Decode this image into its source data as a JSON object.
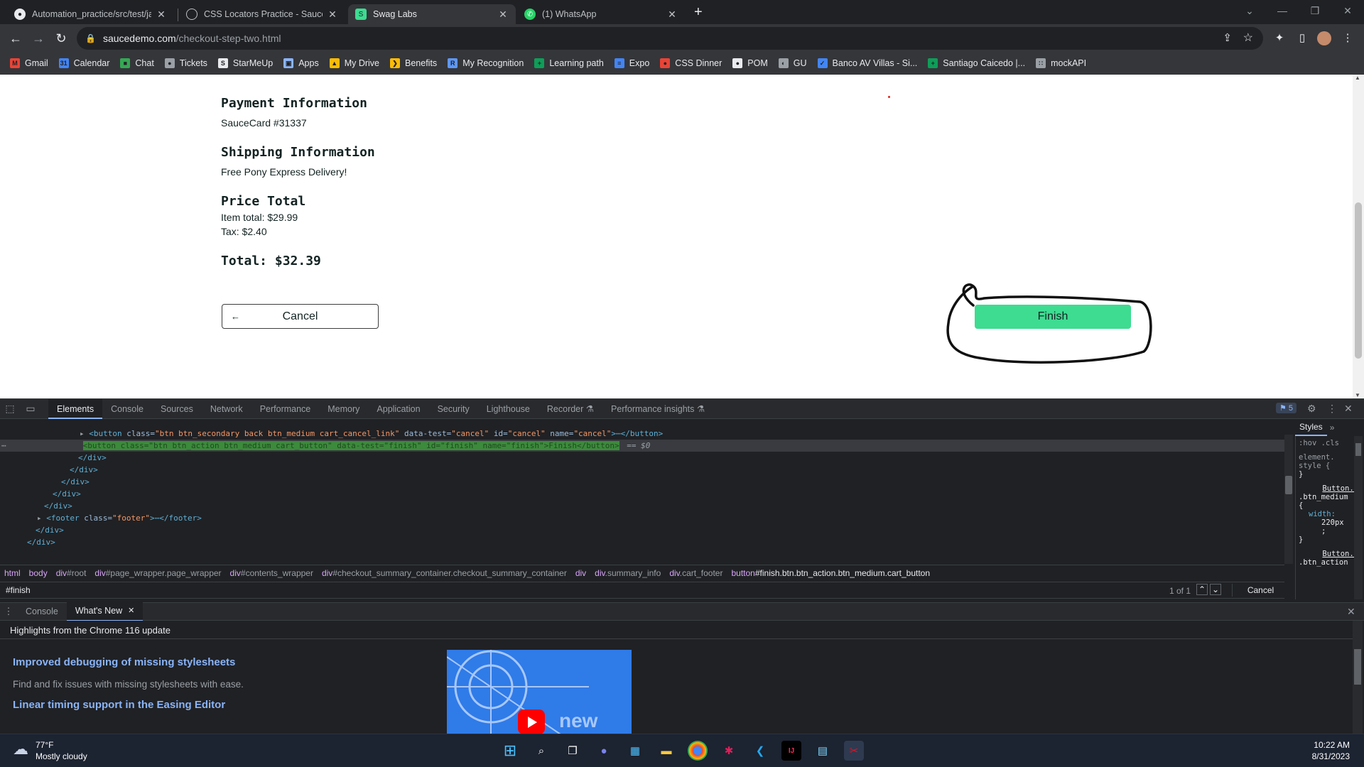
{
  "browser": {
    "tabs": [
      {
        "title": "Automation_practice/src/test/jav",
        "icon": "github-icon",
        "active": false
      },
      {
        "title": "CSS Locators Practice - Saucedem",
        "icon": "globe-icon",
        "active": false
      },
      {
        "title": "Swag Labs",
        "icon": "swag-labs-icon",
        "active": true
      },
      {
        "title": "(1) WhatsApp",
        "icon": "whatsapp-icon",
        "active": false
      }
    ],
    "new_tab": "+",
    "url_host": "saucedemo.com",
    "url_path": "/checkout-step-two.html",
    "bookmarks": [
      {
        "label": "Gmail",
        "color": "#ea4335",
        "glyph": "M"
      },
      {
        "label": "Calendar",
        "color": "#4285f4",
        "glyph": "31"
      },
      {
        "label": "Chat",
        "color": "#34a853",
        "glyph": "■"
      },
      {
        "label": "Tickets",
        "color": "#9aa0a6",
        "glyph": "●"
      },
      {
        "label": "StarMeUp",
        "color": "#e8eaed",
        "glyph": "S"
      },
      {
        "label": "Apps",
        "color": "#8ab4f8",
        "glyph": "▣"
      },
      {
        "label": "My Drive",
        "color": "#fbbc04",
        "glyph": "▲"
      },
      {
        "label": "Benefits",
        "color": "#fbbc04",
        "glyph": "❯"
      },
      {
        "label": "My Recognition",
        "color": "#5e97f6",
        "glyph": "R"
      },
      {
        "label": "Learning path",
        "color": "#0f9d58",
        "glyph": "+"
      },
      {
        "label": "Expo",
        "color": "#4285f4",
        "glyph": "≡"
      },
      {
        "label": "CSS Dinner",
        "color": "#ea4335",
        "glyph": "●"
      },
      {
        "label": "POM",
        "color": "#e8eaed",
        "glyph": "●"
      },
      {
        "label": "GU",
        "color": "#9aa0a6",
        "glyph": "◐"
      },
      {
        "label": "Banco AV Villas - Si...",
        "color": "#4285f4",
        "glyph": "✓"
      },
      {
        "label": "Santiago Caicedo |...",
        "color": "#0f9d58",
        "glyph": "+"
      },
      {
        "label": "mockAPI",
        "color": "#9aa0a6",
        "glyph": "∷"
      }
    ]
  },
  "checkout": {
    "payment_title": "Payment Information",
    "payment_value": "SauceCard #31337",
    "shipping_title": "Shipping Information",
    "shipping_value": "Free Pony Express Delivery!",
    "price_title": "Price Total",
    "item_total": "Item total: $29.99",
    "tax": "Tax: $2.40",
    "total": "Total: $32.39",
    "cancel_label": "Cancel",
    "finish_label": "Finish"
  },
  "devtools": {
    "tabs": [
      "Elements",
      "Console",
      "Sources",
      "Network",
      "Performance",
      "Memory",
      "Application",
      "Security",
      "Lighthouse",
      "Recorder ⚗",
      "Performance insights ⚗"
    ],
    "active_tab": "Elements",
    "issues_count": "5",
    "dom_lines": {
      "l1_open": "<button ",
      "l1_class_n": "class=",
      "l1_class_v": "\"btn btn_secondary back btn_medium cart_cancel_link\"",
      "l1_dt_n": " data-test=",
      "l1_dt_v": "\"cancel\"",
      "l1_id_n": " id=",
      "l1_id_v": "\"cancel\"",
      "l1_name_n": " name=",
      "l1_name_v": "\"cancel\"",
      "l1_close": ">⋯</button>",
      "l2_text": "<button class=\"btn btn_action btn_medium cart_button\" data-test=\"finish\" id=\"finish\" name=\"finish\">Finish</button>",
      "l2_suffix": "== $0",
      "l3": "</div>",
      "l4": "</div>",
      "l5": "</div>",
      "l6": "</div>",
      "l7": "</div>",
      "l8_open": "<footer ",
      "l8_n": "class=",
      "l8_v": "\"footer\"",
      "l8_close": ">⋯</footer>",
      "l9": "</div>",
      "l10": "</div>"
    },
    "breadcrumbs": [
      {
        "tag": "html",
        "rest": ""
      },
      {
        "tag": "body",
        "rest": ""
      },
      {
        "tag": "div",
        "rest": "#root"
      },
      {
        "tag": "div",
        "rest": "#page_wrapper.page_wrapper"
      },
      {
        "tag": "div",
        "rest": "#contents_wrapper"
      },
      {
        "tag": "div",
        "rest": "#checkout_summary_container.checkout_summary_container"
      },
      {
        "tag": "div",
        "rest": ""
      },
      {
        "tag": "div",
        "rest": ".summary_info"
      },
      {
        "tag": "div",
        "rest": ".cart_footer"
      },
      {
        "tag": "button",
        "rest": "#finish.btn.btn_action.btn_medium.cart_button"
      }
    ],
    "search_value": "#finish",
    "search_count": "1 of 1",
    "search_cancel": "Cancel",
    "styles": {
      "tab": "Styles",
      "filter": ":hov .cls",
      "element_style": "element.",
      "element_style2": "style {",
      "rule_close": "}",
      "selector1": "Button.…",
      "selector2": ".btn_medium",
      "brace": "{",
      "prop": "width:",
      "value": "220px",
      "semi": ";",
      "rule_close2": "}",
      "selector3": "Button.…",
      "selector4": ".btn_action"
    },
    "drawer_tabs": [
      "Console",
      "What's New"
    ],
    "whats_new": {
      "header": "Highlights from the Chrome 116 update",
      "item1_title": "Improved debugging of missing stylesheets",
      "item1_desc": "Find and fix issues with missing stylesheets with ease.",
      "item2_title": "Linear timing support in the Easing Editor",
      "video_word": "new"
    }
  },
  "taskbar": {
    "weather_temp": "77°F",
    "weather_desc": "Mostly cloudy",
    "time": "10:22 AM",
    "date": "8/31/2023",
    "apps": [
      "windows-start-icon",
      "search-icon",
      "task-view-icon",
      "teams-chat-icon",
      "store-icon",
      "file-explorer-icon",
      "chrome-icon",
      "slack-icon",
      "vscode-icon",
      "intellij-icon",
      "notepad-icon",
      "snipping-tool-icon"
    ]
  }
}
